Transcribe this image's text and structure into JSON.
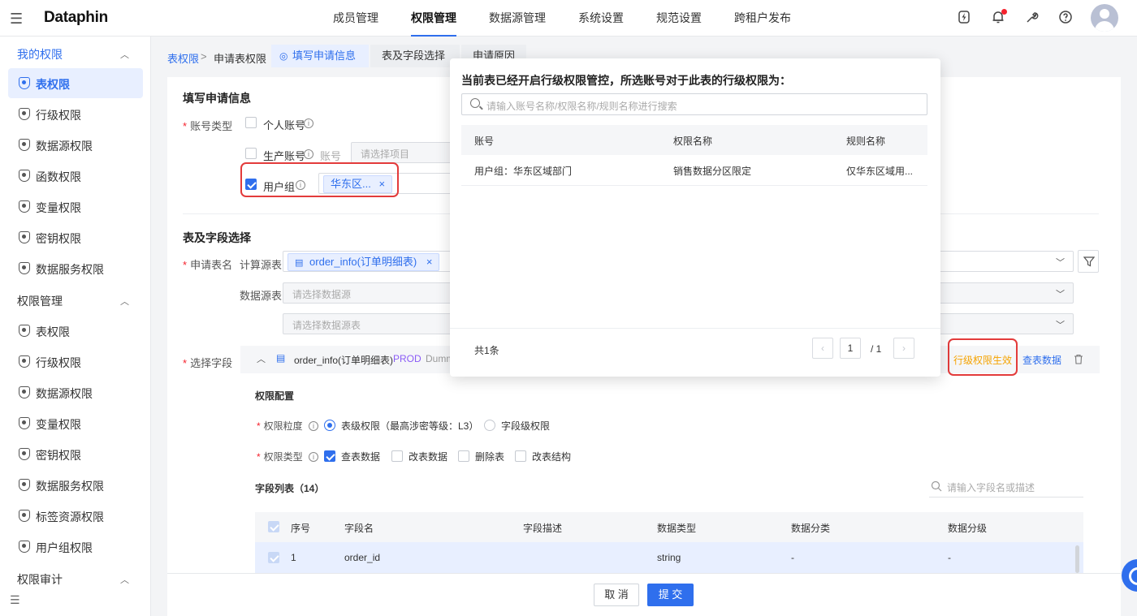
{
  "header": {
    "menu_icon": "hamburger-icon",
    "logo": "Dataphin",
    "nav": [
      "成员管理",
      "权限管理",
      "数据源管理",
      "系统设置",
      "规范设置",
      "跨租户发布"
    ],
    "active_nav": "权限管理",
    "icons": [
      "lightning-icon",
      "bell-icon",
      "wrench-icon",
      "help-icon",
      "avatar"
    ]
  },
  "sidebar": {
    "groups": [
      {
        "label": "我的权限",
        "items": [
          "表权限",
          "行级权限",
          "数据源权限",
          "函数权限",
          "变量权限",
          "密钥权限",
          "数据服务权限"
        ]
      },
      {
        "label": "权限管理",
        "items": [
          "表权限",
          "行级权限",
          "数据源权限",
          "变量权限",
          "密钥权限",
          "数据服务权限",
          "标签资源权限",
          "用户组权限"
        ]
      },
      {
        "label": "权限审计",
        "items": []
      }
    ],
    "active_item": "表权限"
  },
  "breadcrumb": {
    "root": "表权限",
    "separator": ">",
    "current": "申请表权限"
  },
  "steps": [
    "填写申请信息",
    "表及字段选择",
    "申请原因"
  ],
  "form": {
    "section1_title": "填写申请信息",
    "account_type_label": "账号类型",
    "personal_account": "个人账号",
    "prod_account": "生产账号",
    "account_label": "账号",
    "project_placeholder": "请选择项目",
    "user_group": "用户组",
    "user_group_tag": "华东区...",
    "section2_title": "表及字段选择",
    "table_name_label": "申请表名",
    "compute_source_label": "计算源表",
    "compute_source_tag": "order_info(订单明细表)",
    "datasource_table_label": "数据源表",
    "datasource_placeholder": "请选择数据源",
    "datasource_table_placeholder": "请选择数据源表",
    "select_fields_label": "选择字段",
    "field_table_name": "order_info(订单明细表)",
    "field_table_env": "PROD",
    "field_table_extra": "Dumm",
    "row_level_effect": "行级权限生效",
    "view_data": "查表数据",
    "perm_config_title": "权限配置",
    "granularity_label": "权限粒度",
    "table_level": "表级权限（最高涉密等级：L3）",
    "field_level": "字段级权限",
    "perm_type_label": "权限类型",
    "perm_types": [
      "查表数据",
      "改表数据",
      "删除表",
      "改表结构"
    ],
    "field_list_title": "字段列表（14）",
    "field_search_placeholder": "请输入字段名或描述",
    "table_headers": [
      "序号",
      "字段名",
      "字段描述",
      "数据类型",
      "数据分类",
      "数据分级"
    ],
    "table_rows": [
      {
        "index": "1",
        "name": "order_id",
        "desc": "",
        "type": "string",
        "category": "-",
        "level": "-"
      }
    ]
  },
  "footer": {
    "cancel": "取 消",
    "submit": "提 交"
  },
  "popup": {
    "title": "当前表已经开启行级权限管控，所选账号对于此表的行级权限为：",
    "search_placeholder": "请输入账号名称/权限名称/规则名称进行搜索",
    "headers": [
      "账号",
      "权限名称",
      "规则名称"
    ],
    "rows": [
      {
        "account": "用户组：华东区域部门",
        "perm_name": "销售数据分区限定",
        "rule_name": "仅华东区域用..."
      }
    ],
    "total": "共1条",
    "page_current": "1",
    "page_total": "/ 1"
  },
  "colors": {
    "accent": "#2f6fed",
    "highlight_red": "#e33b3b",
    "warning_orange": "#f5a300"
  }
}
